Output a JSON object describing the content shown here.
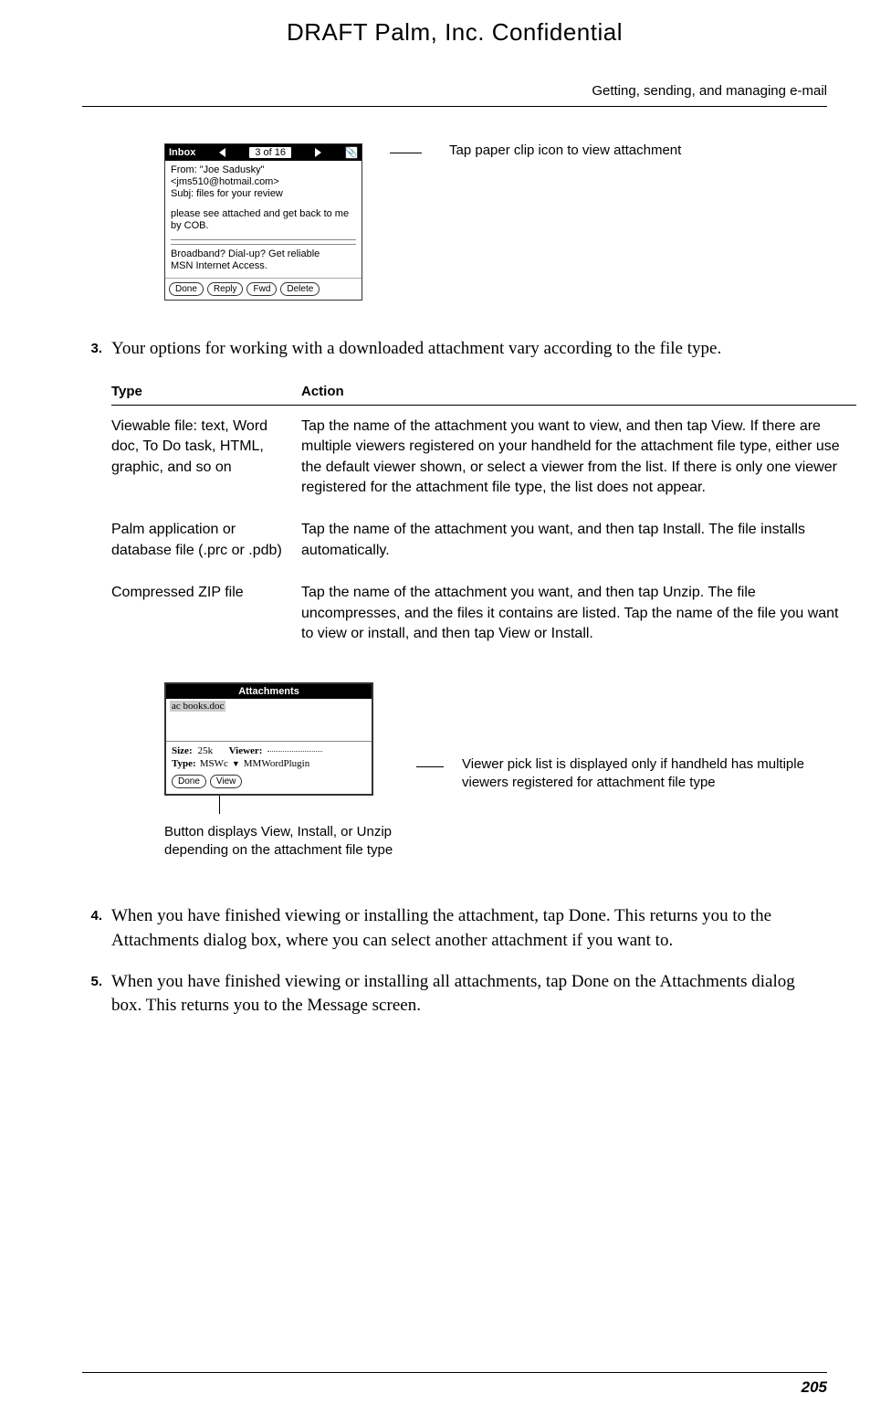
{
  "draft_header": "DRAFT   Palm, Inc. Confidential",
  "running_header": "Getting, sending, and managing e-mail",
  "screenshot1": {
    "title": "Inbox",
    "counter": "3 of 16",
    "from": "From: \"Joe Sadusky\"",
    "email": "<jms510@hotmail.com>",
    "subj": "Subj: files for your review",
    "body": "please see attached and get back to me by COB.",
    "footer1": "Broadband? Dial-up? Get reliable",
    "footer2": "MSN Internet Access.",
    "buttons": [
      "Done",
      "Reply",
      "Fwd",
      "Delete"
    ],
    "callout": "Tap paper clip icon to view attachment"
  },
  "step3": {
    "num": "3.",
    "text": "Your options for working with a downloaded attachment vary according to the file type."
  },
  "table": {
    "head_type": "Type",
    "head_action": "Action",
    "rows": [
      {
        "type": "Viewable file: text, Word doc, To Do task, HTML, graphic, and so on",
        "action": "Tap the name of the attachment you want to view, and then tap View. If there are multiple viewers registered on your handheld for the attachment file type, either use the default viewer shown, or select a viewer from the list. If there is only one viewer registered for the attachment file type, the list does not appear."
      },
      {
        "type": "Palm application or database file (.prc or .pdb)",
        "action": "Tap the name of the attachment you want, and then tap Install. The file installs automatically."
      },
      {
        "type": "Compressed ZIP file",
        "action": "Tap the name of the attachment you want, and then tap Unzip. The file uncompresses, and the files it contains are listed. Tap the name of the file you want to view or install, and then tap View or Install."
      }
    ]
  },
  "screenshot2": {
    "title": "Attachments",
    "filename": "ac books.doc",
    "size_label": "Size:",
    "size_value": "25k",
    "viewer_label": "Viewer:",
    "type_label": "Type:",
    "type_value": "MSWc",
    "plugin": "MMWordPlugin",
    "buttons": [
      "Done",
      "View"
    ],
    "callout_right": "Viewer pick list is displayed only if handheld has multiple viewers registered for attachment file type",
    "callout_below": "Button displays View, Install, or Unzip depending on the attachment file type"
  },
  "step4": {
    "num": "4.",
    "text": "When you have finished viewing or installing the attachment, tap Done. This returns you to the Attachments dialog box, where you can select another attachment if you want to."
  },
  "step5": {
    "num": "5.",
    "text": "When you have finished viewing or installing all attachments, tap Done on the Attachments dialog box. This returns you to the Message screen."
  },
  "page_number": "205"
}
